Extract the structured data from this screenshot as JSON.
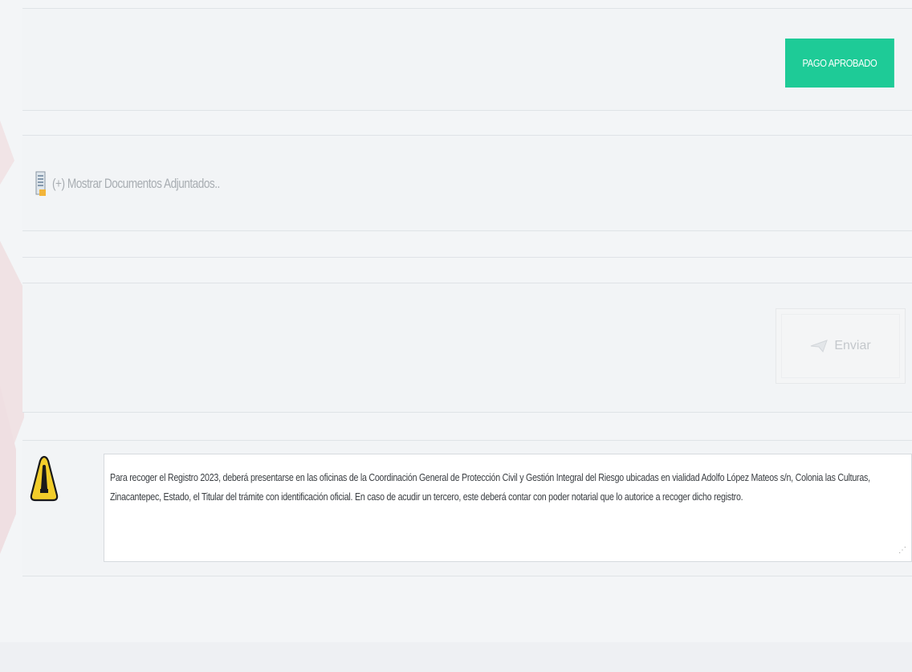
{
  "status_button": {
    "label": "PAGO APROBADO"
  },
  "attachments": {
    "toggle_label": "(+) Mostrar Documentos Adjuntados..",
    "icon": "document-icon"
  },
  "send_button": {
    "label": "Enviar",
    "icon": "send-icon"
  },
  "notice": {
    "icon": "warning-icon",
    "text": "Para recoger el Registro 2023, deberá presentarse en las oficinas de la Coordinación General de Protección Civil y Gestión Integral del Riesgo ubicadas en vialidad Adolfo López Mateos s/n, Colonia las Culturas, Zinacantepec, Estado, el Titular del trámite con identificación oficial. En caso de acudir un tercero, este deberá contar con poder notarial que lo autorice a recoger dicho registro."
  },
  "colors": {
    "approved": "#1ecb97",
    "warning": "#f2cd2a",
    "page_bg": "#f3f5f7"
  }
}
